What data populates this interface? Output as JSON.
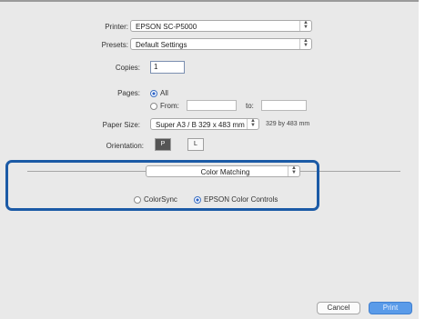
{
  "printer": {
    "label": "Printer:",
    "value": "EPSON SC-P5000"
  },
  "presets": {
    "label": "Presets:",
    "value": "Default Settings"
  },
  "copies": {
    "label": "Copies:",
    "value": "1"
  },
  "pages": {
    "label": "Pages:",
    "all_label": "All",
    "from_label": "From:",
    "to_label": "to:"
  },
  "paper_size": {
    "label": "Paper Size:",
    "value": "Super A3 / B 329 x 483 mm",
    "dims": "329 by 483 mm"
  },
  "orientation": {
    "label": "Orientation:",
    "portrait": "P",
    "landscape": "L"
  },
  "color_section": {
    "panel_value": "Color Matching",
    "option_colorsync": "ColorSync",
    "option_epson": "EPSON Color Controls",
    "selected": "EPSON Color Controls"
  },
  "buttons": {
    "cancel": "Cancel",
    "print": "Print"
  },
  "colors": {
    "highlight": "#1b5aa6",
    "accent": "#5a9be9"
  }
}
